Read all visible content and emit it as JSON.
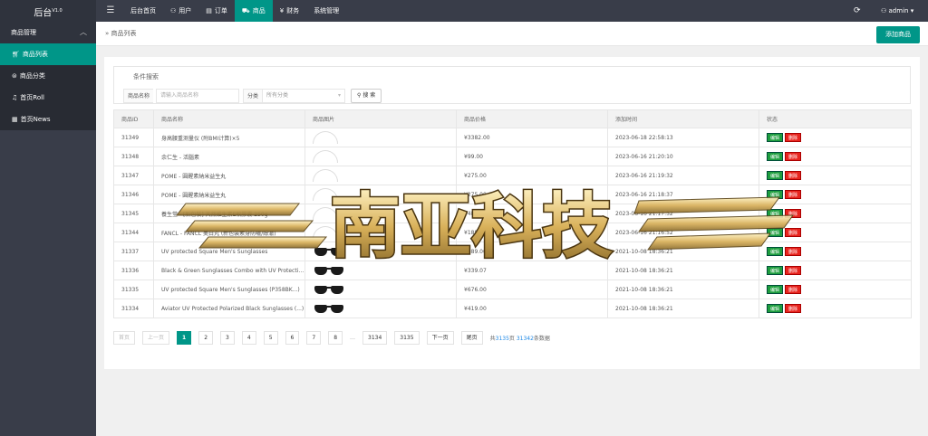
{
  "app": {
    "logo_text": "后台",
    "logo_version": "V1.0"
  },
  "topnav": [
    {
      "label": "后台首页",
      "icon": ""
    },
    {
      "label": "用户",
      "icon": "👤"
    },
    {
      "label": "订单",
      "icon": "▤"
    },
    {
      "label": "商品",
      "icon": "🛒"
    },
    {
      "label": "财务",
      "icon": "¥"
    },
    {
      "label": "系统管理",
      "icon": ""
    }
  ],
  "user": {
    "name": "admin"
  },
  "sidebar": {
    "group_label": "商品管理",
    "items": [
      {
        "label": "商品列表",
        "icon": "cart-icon"
      },
      {
        "label": "商品分类",
        "icon": "category-icon"
      },
      {
        "label": "首页Roll",
        "icon": "bell-icon"
      },
      {
        "label": "首页News",
        "icon": "news-icon"
      }
    ]
  },
  "breadcrumb": "商品列表",
  "add_button": "添加商品",
  "search": {
    "legend": "条件搜索",
    "name_label": "商品名称",
    "name_placeholder": "请输入商品名称",
    "category_label": "分类",
    "category_value": "所有分类",
    "button": "搜 索"
  },
  "table": {
    "headers": [
      "商品ID",
      "商品名称",
      "商品图片",
      "商品价格",
      "添加时间",
      "状态"
    ],
    "edit_label": "编辑",
    "delete_label": "删除",
    "rows": [
      {
        "id": "31349",
        "name": "身高腰重测量仪 (附BMI计算)×5",
        "img": "circle",
        "price": "¥3382.00",
        "time": "2023-06-18 22:58:13"
      },
      {
        "id": "31348",
        "name": "余仁生 - 活腦素",
        "img": "circle",
        "price": "¥99.00",
        "time": "2023-06-16 21:20:10"
      },
      {
        "id": "31347",
        "name": "POME - 圓醒素納米益生丸",
        "img": "circle",
        "price": "¥275.00",
        "time": "2023-06-16 21:19:32"
      },
      {
        "id": "31346",
        "name": "POME - 圓醒素納米益生丸",
        "img": "circle",
        "price": "¥275.00",
        "time": "2023-06-16 21:18:37"
      },
      {
        "id": "31345",
        "name": "養生堂 - [新包裝] 天然維生素E軟膠囊 250g",
        "img": "circle",
        "price": "¥48.00",
        "time": "2023-06-16 21:17:52"
      },
      {
        "id": "31344",
        "name": "FANCL - FANCL 美白丸 (新包裝素身防曬/醇澈)",
        "img": "circle",
        "price": "¥188.00",
        "time": "2023-06-16 21:16:52"
      },
      {
        "id": "31337",
        "name": "UV protected Square Men's Sunglasses",
        "img": "glasses",
        "price": "¥389.00",
        "time": "2021-10-08 18:36:21"
      },
      {
        "id": "31336",
        "name": "Black & Green Sunglasses Combo with UV Protection",
        "img": "glasses",
        "price": "¥339.07",
        "time": "2021-10-08 18:36:21"
      },
      {
        "id": "31335",
        "name": "UV protected Square Men's Sunglasses (P358BK...)",
        "img": "glasses",
        "price": "¥676.00",
        "time": "2021-10-08 18:36:21"
      },
      {
        "id": "31334",
        "name": "Aviator UV Protected Polarized Black Sunglasses (...)",
        "img": "glasses",
        "price": "¥419.00",
        "time": "2021-10-08 18:36:21"
      }
    ]
  },
  "pager": {
    "first": "首页",
    "prev": "上一页",
    "pages": [
      "1",
      "2",
      "3",
      "4",
      "5",
      "6",
      "7",
      "8"
    ],
    "ellipsis": "…",
    "tail_pages": [
      "3134",
      "3135"
    ],
    "next": "下一页",
    "last": "尾页",
    "info_prefix": "共",
    "total_pages": "3135",
    "info_mid": "页 ",
    "total_rows": "31342",
    "info_suffix": "条数据"
  },
  "watermark_text": "南亚科技",
  "colors": {
    "accent": "#009688",
    "topbar": "#393d49",
    "danger": "#e8251f",
    "edit": "#1e9e3e"
  }
}
